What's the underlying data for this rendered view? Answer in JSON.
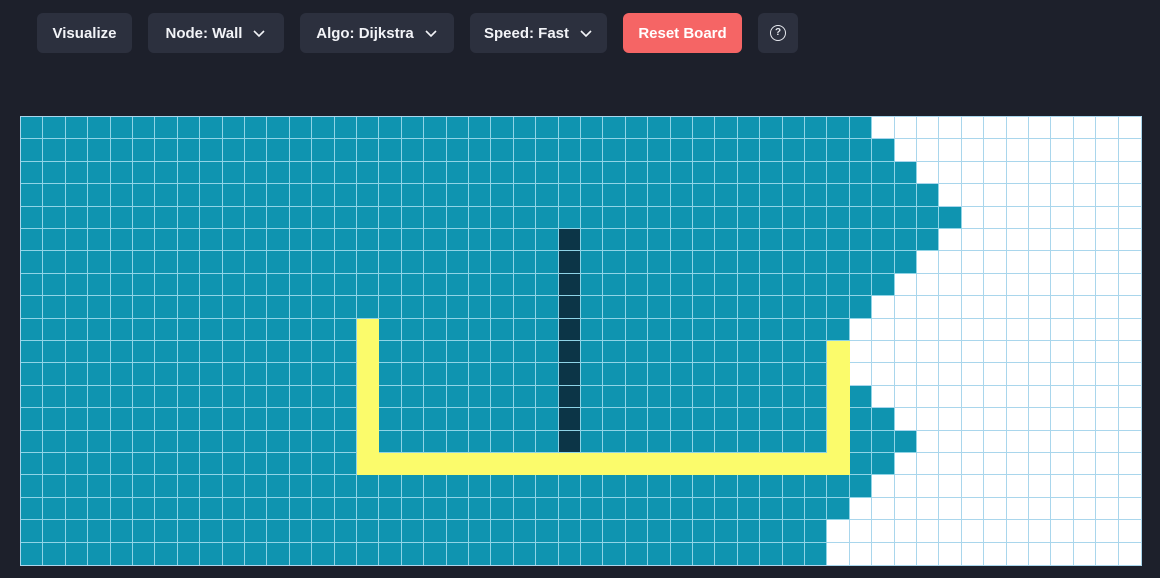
{
  "toolbar": {
    "visualize_label": "Visualize",
    "node_label": "Node: Wall",
    "algo_label": "Algo: Dijkstra",
    "speed_label": "Speed: Fast",
    "reset_label": "Reset Board",
    "help_symbol": "?"
  },
  "colors": {
    "background": "#1d202b",
    "button": "#2c303e",
    "reset": "#f56565",
    "visited": "#0f94b0",
    "wall": "#0c3547",
    "path": "#fbfb6b",
    "unvisited": "#ffffff",
    "grid_line": "#a9d6ec"
  },
  "board": {
    "rows": 20,
    "cols": 50,
    "visited_extent_per_row": [
      38,
      39,
      40,
      41,
      42,
      41,
      40,
      39,
      38,
      37,
      36,
      37,
      38,
      39,
      40,
      39,
      38,
      37,
      36,
      36
    ],
    "walls": [
      [
        5,
        24
      ],
      [
        6,
        24
      ],
      [
        7,
        24
      ],
      [
        8,
        24
      ],
      [
        9,
        24
      ],
      [
        10,
        24
      ],
      [
        11,
        24
      ],
      [
        12,
        24
      ],
      [
        13,
        24
      ],
      [
        14,
        24
      ]
    ],
    "path": [
      [
        9,
        15
      ],
      [
        10,
        15
      ],
      [
        11,
        15
      ],
      [
        12,
        15
      ],
      [
        13,
        15
      ],
      [
        14,
        15
      ],
      [
        15,
        15
      ],
      [
        15,
        16
      ],
      [
        15,
        17
      ],
      [
        15,
        18
      ],
      [
        15,
        19
      ],
      [
        15,
        20
      ],
      [
        15,
        21
      ],
      [
        15,
        22
      ],
      [
        15,
        23
      ],
      [
        15,
        24
      ],
      [
        15,
        25
      ],
      [
        15,
        26
      ],
      [
        15,
        27
      ],
      [
        15,
        28
      ],
      [
        15,
        29
      ],
      [
        15,
        30
      ],
      [
        15,
        31
      ],
      [
        15,
        32
      ],
      [
        15,
        33
      ],
      [
        15,
        34
      ],
      [
        15,
        35
      ],
      [
        15,
        36
      ],
      [
        14,
        36
      ],
      [
        13,
        36
      ],
      [
        12,
        36
      ],
      [
        11,
        36
      ],
      [
        10,
        36
      ]
    ]
  }
}
